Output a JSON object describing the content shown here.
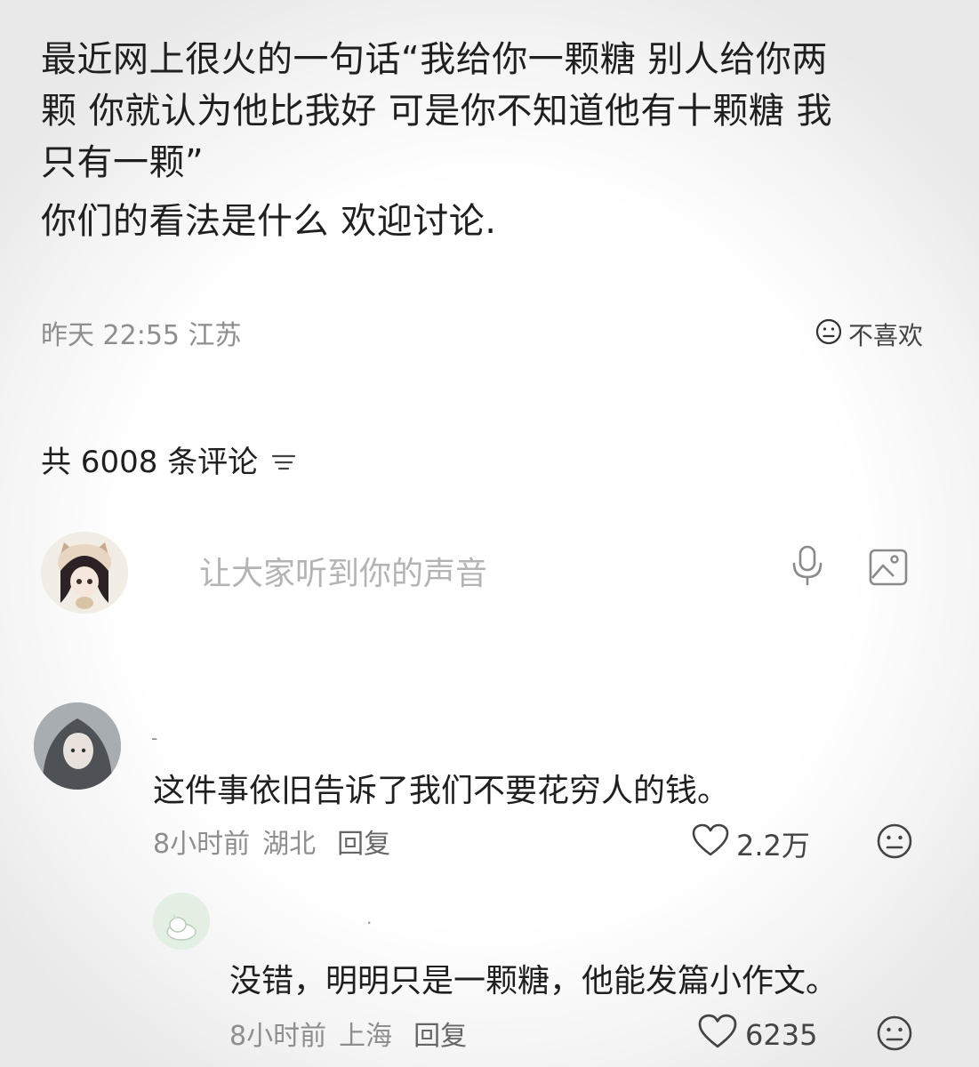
{
  "post": {
    "lines": [
      "最近网上很火的一句话“我给你一颗糖 别人给你两",
      "颗 你就认为他比我好 可是你不知道他有十颗糖 我",
      "只有一颗”"
    ],
    "question": "你们的看法是什么 欢迎讨论.",
    "time": "昨天 22:55 江苏",
    "dislike_label": "不喜欢"
  },
  "comments_header": {
    "label": "共 6008 条评论"
  },
  "composer": {
    "placeholder": "让大家听到你的声音"
  },
  "comments": [
    {
      "name": "-",
      "text": "这件事依旧告诉了我们不要花穷人的钱。",
      "time": "8小时前",
      "location": "湖北",
      "reply_label": "回复",
      "likes": "2.2万"
    },
    {
      "name": "·",
      "text": "没错，明明只是一颗糖，他能发篇小作文。",
      "time": "8小时前",
      "location": "上海",
      "reply_label": "回复",
      "likes": "6235"
    }
  ],
  "icons": {
    "dislike": "neutral-face-icon",
    "sort": "sort-lines-icon",
    "mic": "microphone-icon",
    "image": "image-icon",
    "like": "heart-outline-icon",
    "react": "neutral-face-icon"
  }
}
